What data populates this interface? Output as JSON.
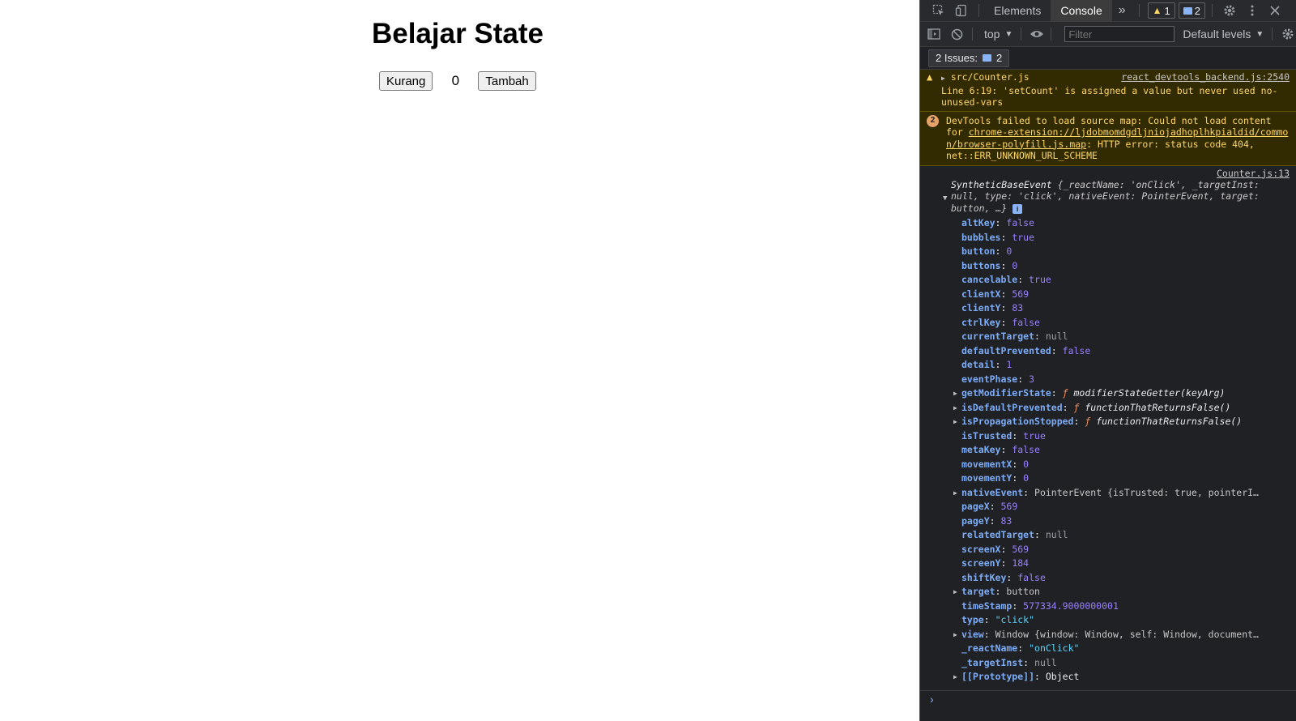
{
  "page": {
    "heading": "Belajar State",
    "decrement_label": "Kurang",
    "count": "0",
    "increment_label": "Tambah"
  },
  "devtools": {
    "tabs": [
      "Elements",
      "Console"
    ],
    "active_tab": "Console",
    "more_tabs": "»",
    "warning_count": "1",
    "message_count": "2",
    "context": "top",
    "filter_placeholder": "Filter",
    "levels": "Default levels",
    "issues_label": "2 Issues:",
    "issues_count": "2",
    "messages": {
      "warning": {
        "source_file": "src/Counter.js",
        "link": "react_devtools_backend.js:2540",
        "text": "Line 6:19:  'setCount' is assigned a value but never used  no-unused-vars"
      },
      "sourcemap": {
        "repeat": "2",
        "text_before": "DevTools failed to load source map: Could not load content for ",
        "url": "chrome-extension://ljdobmomdgdljniojadhoplhkpialdid/common/browser-polyfill.js.map",
        "text_after": ": HTTP error: status code 404, net::ERR_UNKNOWN_URL_SCHEME"
      },
      "log": {
        "link": "Counter.js:13",
        "class_name": "SyntheticBaseEvent",
        "summary": "{_reactName: 'onClick', _targetInst: null, type: 'click', nativeEvent: PointerEvent, target: button, …}",
        "properties": [
          {
            "key": "altKey",
            "value": "false",
            "type": "bool",
            "expandable": false
          },
          {
            "key": "bubbles",
            "value": "true",
            "type": "bool",
            "expandable": false
          },
          {
            "key": "button",
            "value": "0",
            "type": "num",
            "expandable": false
          },
          {
            "key": "buttons",
            "value": "0",
            "type": "num",
            "expandable": false
          },
          {
            "key": "cancelable",
            "value": "true",
            "type": "bool",
            "expandable": false
          },
          {
            "key": "clientX",
            "value": "569",
            "type": "num",
            "expandable": false
          },
          {
            "key": "clientY",
            "value": "83",
            "type": "num",
            "expandable": false
          },
          {
            "key": "ctrlKey",
            "value": "false",
            "type": "bool",
            "expandable": false
          },
          {
            "key": "currentTarget",
            "value": "null",
            "type": "null",
            "expandable": false
          },
          {
            "key": "defaultPrevented",
            "value": "false",
            "type": "bool",
            "expandable": false
          },
          {
            "key": "detail",
            "value": "1",
            "type": "num",
            "expandable": false
          },
          {
            "key": "eventPhase",
            "value": "3",
            "type": "num",
            "expandable": false
          },
          {
            "key": "getModifierState",
            "value": "modifierStateGetter(keyArg)",
            "type": "fn",
            "expandable": true
          },
          {
            "key": "isDefaultPrevented",
            "value": "functionThatReturnsFalse()",
            "type": "fn",
            "expandable": true
          },
          {
            "key": "isPropagationStopped",
            "value": "functionThatReturnsFalse()",
            "type": "fn",
            "expandable": true
          },
          {
            "key": "isTrusted",
            "value": "true",
            "type": "bool",
            "expandable": false
          },
          {
            "key": "metaKey",
            "value": "false",
            "type": "bool",
            "expandable": false
          },
          {
            "key": "movementX",
            "value": "0",
            "type": "num",
            "expandable": false
          },
          {
            "key": "movementY",
            "value": "0",
            "type": "num",
            "expandable": false
          },
          {
            "key": "nativeEvent",
            "value": "PointerEvent {isTrusted: true, pointerI…",
            "type": "obj",
            "expandable": true
          },
          {
            "key": "pageX",
            "value": "569",
            "type": "num",
            "expandable": false
          },
          {
            "key": "pageY",
            "value": "83",
            "type": "num",
            "expandable": false
          },
          {
            "key": "relatedTarget",
            "value": "null",
            "type": "null",
            "expandable": false
          },
          {
            "key": "screenX",
            "value": "569",
            "type": "num",
            "expandable": false
          },
          {
            "key": "screenY",
            "value": "184",
            "type": "num",
            "expandable": false
          },
          {
            "key": "shiftKey",
            "value": "false",
            "type": "bool",
            "expandable": false
          },
          {
            "key": "target",
            "value": "button",
            "type": "obj",
            "expandable": true
          },
          {
            "key": "timeStamp",
            "value": "577334.9000000001",
            "type": "num",
            "expandable": false
          },
          {
            "key": "type",
            "value": "\"click\"",
            "type": "str",
            "expandable": false
          },
          {
            "key": "view",
            "value": "Window {window: Window, self: Window, document…",
            "type": "obj",
            "expandable": true
          },
          {
            "key": "_reactName",
            "value": "\"onClick\"",
            "type": "str",
            "expandable": false
          },
          {
            "key": "_targetInst",
            "value": "null",
            "type": "null",
            "expandable": false
          },
          {
            "key": "[[Prototype]]",
            "value": "Object",
            "type": "plain",
            "expandable": true
          }
        ]
      }
    },
    "prompt_symbol": "›",
    "colors": {
      "bg": "#202124",
      "warning_bg": "#332b00",
      "warning_text": "#ffd666",
      "key": "#7cacf8",
      "number": "#9980ff",
      "string": "#5cd5fb"
    }
  }
}
